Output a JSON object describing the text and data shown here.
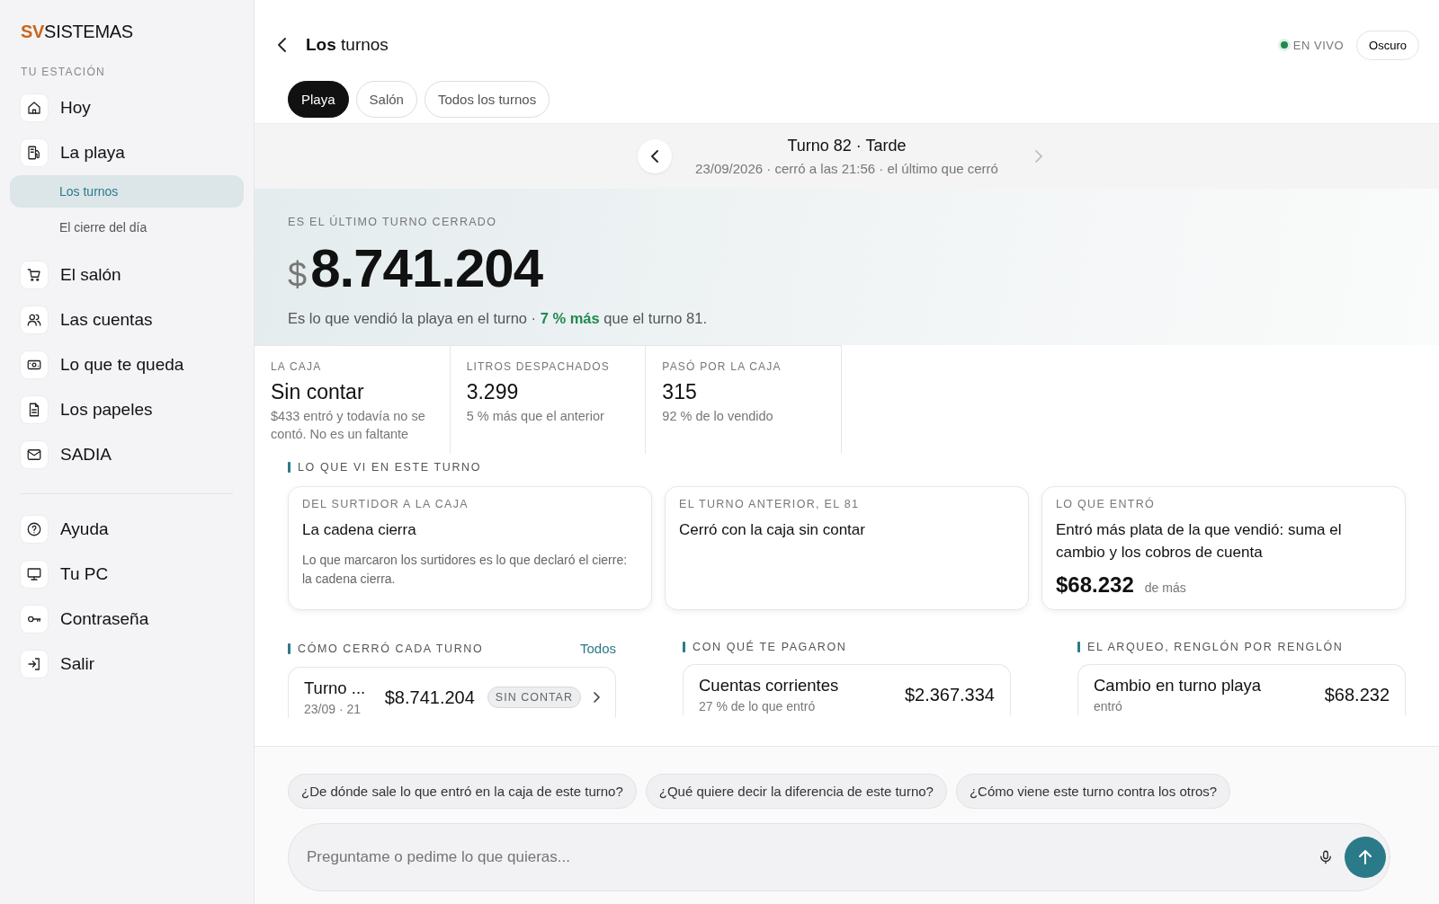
{
  "brand": {
    "prefix": "SV",
    "name": "SISTEMAS"
  },
  "sidebar": {
    "section": "TU ESTACIÓN",
    "items": [
      {
        "label": "Hoy",
        "selected": false
      },
      {
        "label": "La playa",
        "selected": false,
        "children": [
          {
            "label": "Los turnos",
            "selected": true
          },
          {
            "label": "El cierre del día",
            "selected": false
          }
        ]
      },
      {
        "label": "El salón",
        "selected": false
      },
      {
        "label": "Las cuentas",
        "selected": false
      },
      {
        "label": "Lo que te queda",
        "selected": false
      },
      {
        "label": "Los papeles",
        "selected": false
      },
      {
        "label": "SADIA",
        "selected": false
      }
    ],
    "footer_items": [
      {
        "label": "Ayuda"
      },
      {
        "label": "Tu PC"
      },
      {
        "label": "Contraseña"
      },
      {
        "label": "Salir"
      }
    ]
  },
  "header": {
    "title": "**Los** turnos",
    "live": {
      "label": "EN VIVO",
      "on": true
    },
    "theme_button": "Oscuro"
  },
  "filters": [
    {
      "label": "Playa",
      "selected": true
    },
    {
      "label": "Salón",
      "selected": false
    },
    {
      "label": "Todos los turnos",
      "selected": false
    }
  ],
  "turno_nav": {
    "title": "Turno 82 · Tarde",
    "subtitle": "23/09/2026 · cerró a las 21:56 · el último que cerró",
    "next_disabled": true
  },
  "hero": {
    "eyebrow": "ES EL ÚLTIMO TURNO CERRADO",
    "currency": "$",
    "amount": "8.741.204",
    "note": "Es lo que vendió la playa en el turno · **7 % más** que el turno 81."
  },
  "stats": [
    {
      "label": "LA CAJA",
      "value": "Sin contar",
      "note": "$433 entró y todavía no se contó. No es un faltante"
    },
    {
      "label": "LITROS DESPACHADOS",
      "value": "3.299",
      "note": "5 % más que el anterior"
    },
    {
      "label": "PASÓ POR LA CAJA",
      "value": "315",
      "note": "92 % de lo vendido"
    }
  ],
  "insights": {
    "title": "LO QUE VI EN ESTE TURNO",
    "cards": [
      {
        "eyebrow": "DEL SURTIDOR A LA CAJA",
        "title": "La cadena cierra",
        "body": "Lo que marcaron los surtidores es lo que declaró el cierre: la cadena cierra."
      },
      {
        "eyebrow": "EL TURNO ANTERIOR, EL 81",
        "title": "Cerró con la caja sin contar"
      },
      {
        "eyebrow": "LO QUE ENTRÓ",
        "title": "Entró más plata de la que vendió: suma el cambio y los cobros de cuenta",
        "amount": "$68.232",
        "amount_note": "de más"
      }
    ]
  },
  "columns": [
    {
      "title": "CÓMO CERRÓ CADA TURNO",
      "link": "Todos",
      "rows": [
        {
          "name": "Turno ...",
          "note": "23/09 · 21",
          "amount": "$8.741.204",
          "badge": "SIN CONTAR"
        }
      ]
    },
    {
      "title": "CON QUÉ TE PAGARON",
      "rows": [
        {
          "name": "Cuentas corrientes",
          "note": "27 % de lo que entró",
          "amount": "$2.367.334"
        }
      ]
    },
    {
      "title": "EL ARQUEO, RENGLÓN POR RENGLÓN",
      "rows": [
        {
          "name": "Cambio en turno playa",
          "note": "entró",
          "amount": "$68.232"
        }
      ]
    }
  ],
  "chat": {
    "suggestions": [
      "¿De dónde sale lo que entró en la caja de este turno?",
      "¿Qué quiere decir la diferencia de este turno?",
      "¿Cómo viene este turno contra los otros?"
    ],
    "placeholder": "Preguntame o pedime lo que quieras..."
  }
}
